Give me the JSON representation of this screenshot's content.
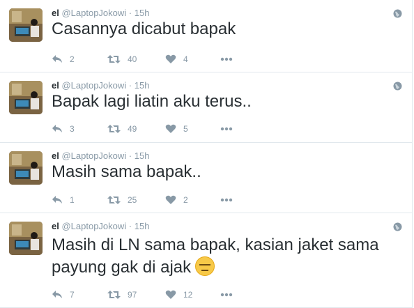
{
  "colors": {
    "text": "#292f33",
    "muted": "#8899a6",
    "border": "#e1e8ed"
  },
  "tweets": [
    {
      "name": "el",
      "handle": "@LaptopJokowi",
      "dot": "·",
      "time": "15h",
      "text": "Casannya dicabut bapak",
      "replies": "2",
      "retweets": "40",
      "likes": "4"
    },
    {
      "name": "el",
      "handle": "@LaptopJokowi",
      "dot": "·",
      "time": "15h",
      "text": "Bapak lagi liatin aku terus..",
      "replies": "3",
      "retweets": "49",
      "likes": "5"
    },
    {
      "name": "el",
      "handle": "@LaptopJokowi",
      "dot": "·",
      "time": "15h",
      "text": "Masih sama bapak..",
      "replies": "1",
      "retweets": "25",
      "likes": "2"
    },
    {
      "name": "el",
      "handle": "@LaptopJokowi",
      "dot": "·",
      "time": "15h",
      "text": "Masih di LN sama bapak,  kasian jaket sama payung gak di ajak",
      "emoji": "expressionless-face-emoji",
      "replies": "7",
      "retweets": "97",
      "likes": "12"
    }
  ],
  "icons": {
    "reply": "reply-icon",
    "retweet": "retweet-icon",
    "like": "heart-icon",
    "more": "more-icon",
    "globe": "globe-icon"
  }
}
